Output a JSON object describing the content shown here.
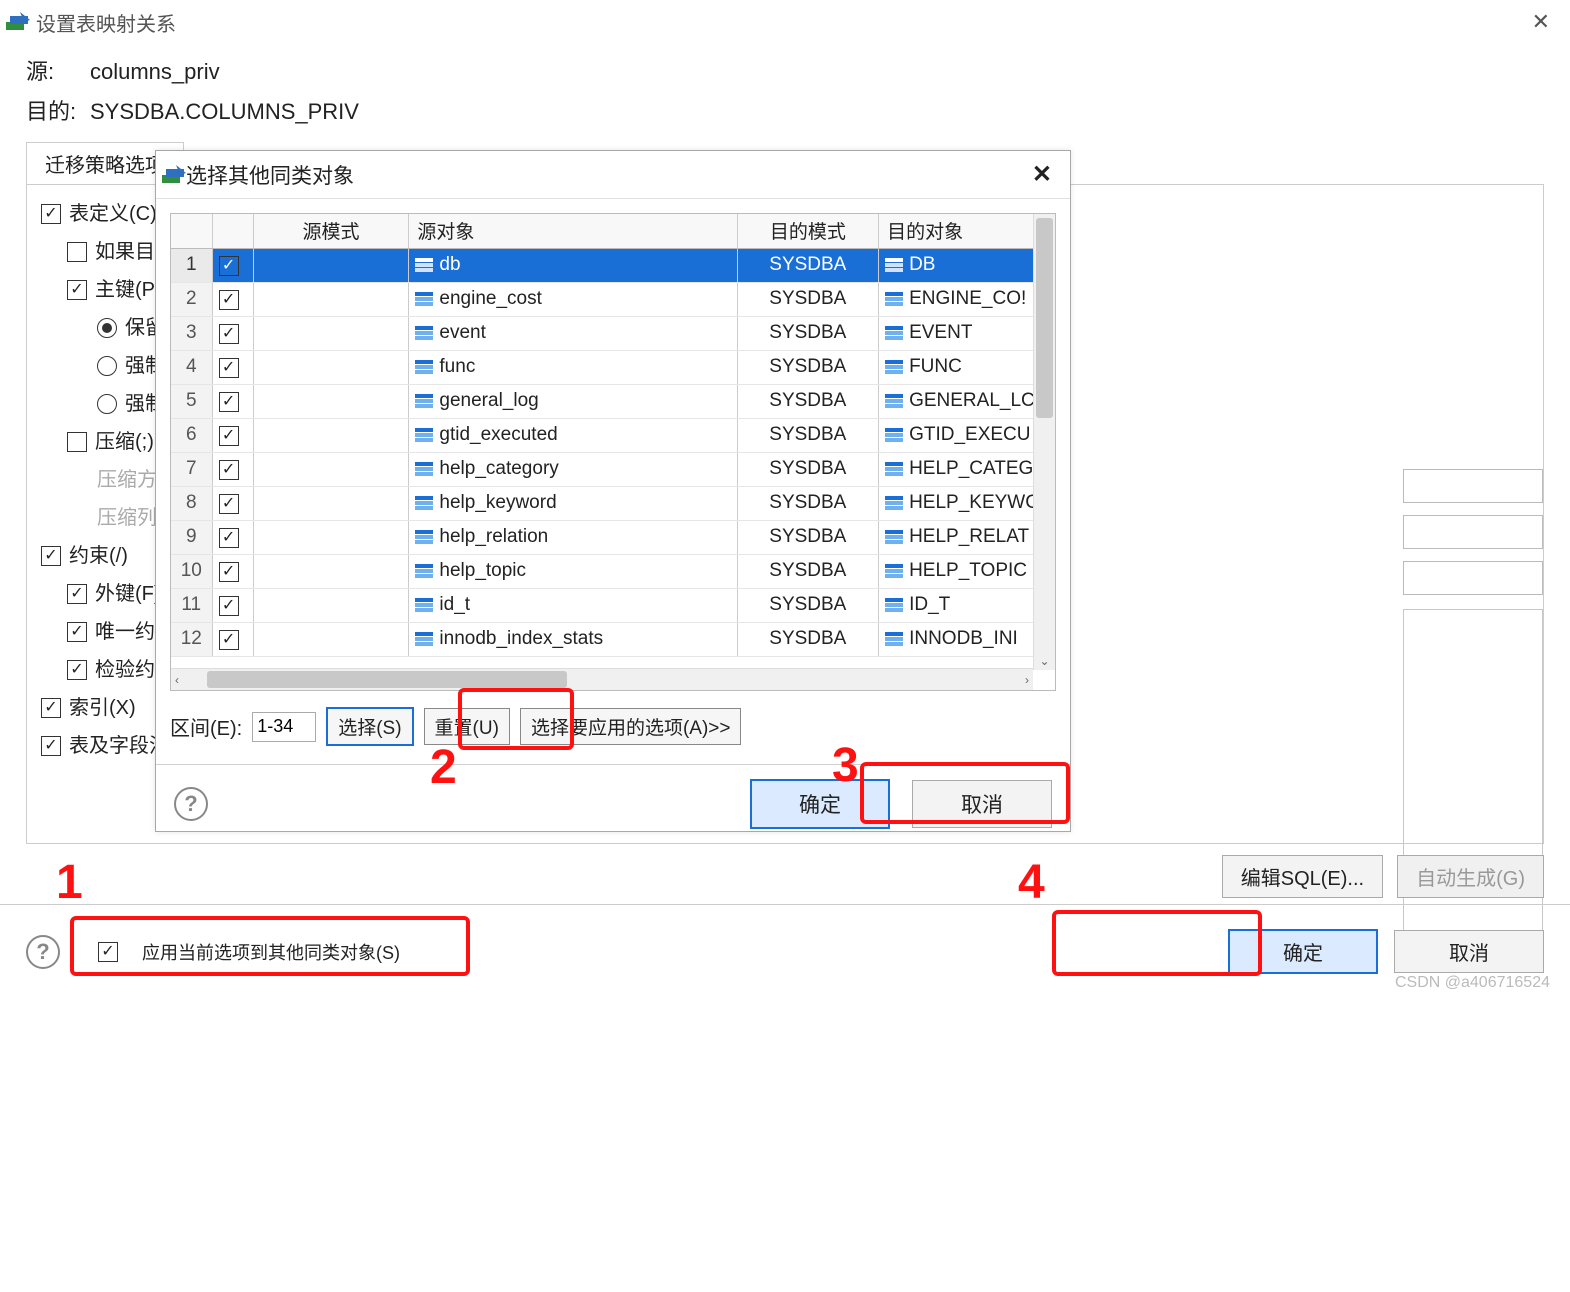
{
  "window": {
    "title": "设置表映射关系",
    "close_glyph": "✕"
  },
  "header": {
    "source_label": "源:",
    "source_value": "columns_priv",
    "dest_label": "目的:",
    "dest_value": "SYSDBA.COLUMNS_PRIV"
  },
  "tabs": {
    "active": "迁移策略选项"
  },
  "tree": {
    "table_def": "表定义(C)",
    "if_dest": "如果目的",
    "pk": "主键(P)",
    "pk_keep": "保留主",
    "pk_force_cluster": "强制聚",
    "pk_force_non": "强制非",
    "compress": "压缩(;)",
    "compress_mode": "压缩方式(",
    "compress_col": "压缩列(O",
    "constraint": "约束(/)",
    "fk": "外键(F)",
    "unique": "唯一约束",
    "check": "检验约束",
    "index": "索引(X)",
    "table_field_note": "表及字段注"
  },
  "bottombar": {
    "edit_sql": "编辑SQL(E)...",
    "auto_gen": "自动生成(G)"
  },
  "footer": {
    "apply_label": "应用当前选项到其他同类对象(S)",
    "ok": "确定",
    "cancel": "取消"
  },
  "modal": {
    "title": "选择其他同类对象",
    "columns": {
      "rownum": "",
      "check": "",
      "src_schema": "源模式",
      "src_obj": "源对象",
      "dst_schema": "目的模式",
      "dst_obj": "目的对象"
    },
    "rows": [
      {
        "n": "1",
        "checked": true,
        "src_schema": "",
        "src_obj": "db",
        "dst_schema": "SYSDBA",
        "dst_obj": "DB",
        "selected": true
      },
      {
        "n": "2",
        "checked": true,
        "src_schema": "",
        "src_obj": "engine_cost",
        "dst_schema": "SYSDBA",
        "dst_obj": "ENGINE_CO!"
      },
      {
        "n": "3",
        "checked": true,
        "src_schema": "",
        "src_obj": "event",
        "dst_schema": "SYSDBA",
        "dst_obj": "EVENT"
      },
      {
        "n": "4",
        "checked": true,
        "src_schema": "",
        "src_obj": "func",
        "dst_schema": "SYSDBA",
        "dst_obj": "FUNC"
      },
      {
        "n": "5",
        "checked": true,
        "src_schema": "",
        "src_obj": "general_log",
        "dst_schema": "SYSDBA",
        "dst_obj": "GENERAL_LC"
      },
      {
        "n": "6",
        "checked": true,
        "src_schema": "",
        "src_obj": "gtid_executed",
        "dst_schema": "SYSDBA",
        "dst_obj": "GTID_EXECU"
      },
      {
        "n": "7",
        "checked": true,
        "src_schema": "",
        "src_obj": "help_category",
        "dst_schema": "SYSDBA",
        "dst_obj": "HELP_CATEG"
      },
      {
        "n": "8",
        "checked": true,
        "src_schema": "",
        "src_obj": "help_keyword",
        "dst_schema": "SYSDBA",
        "dst_obj": "HELP_KEYWC"
      },
      {
        "n": "9",
        "checked": true,
        "src_schema": "",
        "src_obj": "help_relation",
        "dst_schema": "SYSDBA",
        "dst_obj": "HELP_RELAT"
      },
      {
        "n": "10",
        "checked": true,
        "src_schema": "",
        "src_obj": "help_topic",
        "dst_schema": "SYSDBA",
        "dst_obj": "HELP_TOPIC"
      },
      {
        "n": "11",
        "checked": true,
        "src_schema": "",
        "src_obj": "id_t",
        "dst_schema": "SYSDBA",
        "dst_obj": "ID_T"
      },
      {
        "n": "12",
        "checked": true,
        "src_schema": "",
        "src_obj": "innodb_index_stats",
        "dst_schema": "SYSDBA",
        "dst_obj": "INNODB_INI"
      }
    ],
    "range_label": "区间(E):",
    "range_value": "1-34",
    "select_btn": "选择(S)",
    "reset_btn": "重置(U)",
    "apply_opts_btn": "选择要应用的选项(A)>>",
    "ok": "确定",
    "cancel": "取消"
  },
  "annotations": {
    "n1": "1",
    "n2": "2",
    "n3": "3",
    "n4": "4"
  },
  "watermark": "CSDN @a406716524"
}
